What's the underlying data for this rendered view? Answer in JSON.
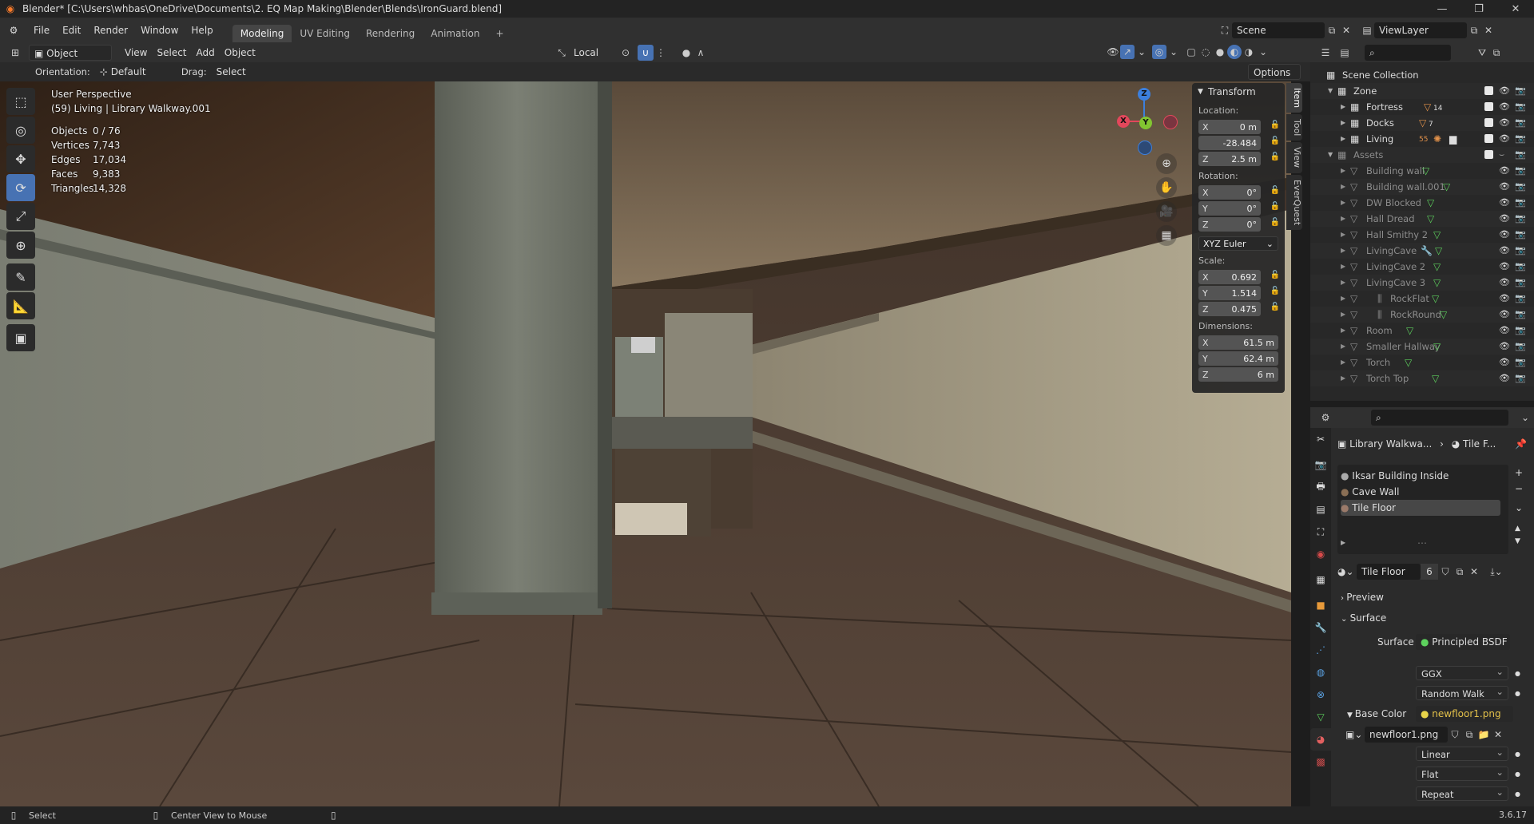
{
  "window": {
    "title": "Blender* [C:\\Users\\whbas\\OneDrive\\Documents\\2. EQ Map Making\\Blender\\Blends\\IronGuard.blend]",
    "minimize": "—",
    "maximize": "❐",
    "close": "✕"
  },
  "menu": {
    "items": [
      "File",
      "Edit",
      "Render",
      "Window",
      "Help"
    ],
    "workspaces": [
      "Modeling",
      "UV Editing",
      "Rendering",
      "Animation"
    ],
    "add_workspace": "+",
    "scene": "Scene",
    "view_layer": "ViewLayer"
  },
  "viewport_header": {
    "mode": "Object Mode",
    "menus": [
      "View",
      "Select",
      "Add",
      "Object"
    ],
    "transform_space": "Local",
    "options": "Options",
    "orientation_label": "Orientation:",
    "orientation_value": "Default",
    "drag_label": "Drag:",
    "drag_value": "Select Box"
  },
  "viewport_overlay": {
    "perspective": "User Perspective",
    "context": "(59) Living | Library Walkway.001",
    "stats": [
      {
        "label": "Objects",
        "value": "0 / 76"
      },
      {
        "label": "Vertices",
        "value": "7,743"
      },
      {
        "label": "Edges",
        "value": "17,034"
      },
      {
        "label": "Faces",
        "value": "9,383"
      },
      {
        "label": "Triangles",
        "value": "14,328"
      }
    ]
  },
  "gizmo": {
    "x": "X",
    "y": "Y",
    "z": "Z"
  },
  "transform": {
    "title": "Transform",
    "location_label": "Location:",
    "location": [
      {
        "axis": "X",
        "value": "0 m"
      },
      {
        "axis": "",
        "value": "-28.484"
      },
      {
        "axis": "Z",
        "value": "2.5 m"
      }
    ],
    "rotation_label": "Rotation:",
    "rotation": [
      {
        "axis": "X",
        "value": "0°"
      },
      {
        "axis": "Y",
        "value": "0°"
      },
      {
        "axis": "Z",
        "value": "0°"
      }
    ],
    "rotation_mode": "XYZ Euler",
    "scale_label": "Scale:",
    "scale": [
      {
        "axis": "X",
        "value": "0.692"
      },
      {
        "axis": "Y",
        "value": "1.514"
      },
      {
        "axis": "Z",
        "value": "0.475"
      }
    ],
    "dimensions_label": "Dimensions:",
    "dimensions": [
      {
        "axis": "X",
        "value": "61.5 m"
      },
      {
        "axis": "Y",
        "value": "62.4 m"
      },
      {
        "axis": "Z",
        "value": "6 m"
      }
    ]
  },
  "side_tabs": [
    "Item",
    "Tool",
    "View",
    "EverQuest"
  ],
  "outliner": {
    "root": "Scene Collection",
    "zone": "Zone",
    "zone_children": [
      {
        "name": "Fortress",
        "badge": "14"
      },
      {
        "name": "Docks",
        "badge": "7"
      },
      {
        "name": "Living",
        "badge": "55"
      }
    ],
    "assets": "Assets",
    "asset_items": [
      "Building wall",
      "Building wall.001",
      "DW Blocked",
      "Hall Dread",
      "Hall Smithy 2",
      "LivingCave",
      "LivingCave 2",
      "LivingCave 3",
      "RockFlat",
      "RockRound",
      "Room",
      "Smaller Hallway",
      "Torch",
      "Torch Top"
    ]
  },
  "properties": {
    "breadcrumb_object": "Library Walkwa...",
    "breadcrumb_material": "Tile F...",
    "slots": [
      "Iksar Building Inside",
      "Cave Wall",
      "Tile Floor"
    ],
    "material_name": "Tile Floor",
    "user_count": "6",
    "preview": "Preview",
    "surface_section": "Surface",
    "surface_label": "Surface",
    "surface_value": "Principled BSDF",
    "distribution": "GGX",
    "subsurface": "Random Walk",
    "base_color_label": "Base Color",
    "base_color_value": "newfloor1.png",
    "image_name": "newfloor1.png",
    "interpolation": "Linear",
    "projection": "Flat",
    "extension": "Repeat"
  },
  "statusbar": {
    "select": "Select",
    "center_view": "Center View to Mouse",
    "version": "3.6.17"
  }
}
